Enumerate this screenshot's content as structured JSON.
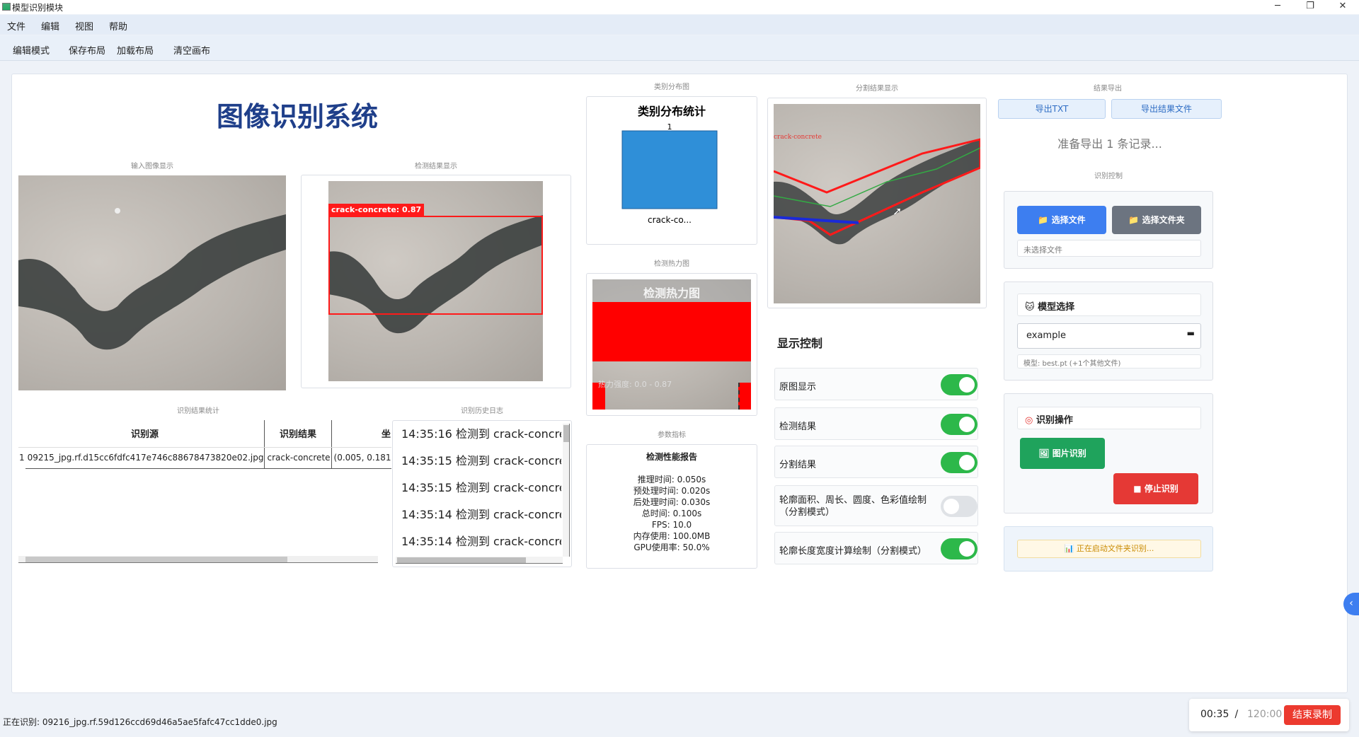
{
  "window": {
    "title": "模型识别模块",
    "minimize": "─",
    "restore": "❐",
    "close": "✕"
  },
  "menu": [
    "文件",
    "编辑",
    "视图",
    "帮助"
  ],
  "toolbar": [
    "编辑模式",
    "保存布局",
    "加载布局",
    "清空画布"
  ],
  "main_title": "图像识别系统",
  "sections": {
    "input_image": "输入图像显示",
    "detect_result": "检测结果显示",
    "result_stats": "识别结果统计",
    "history_log": "识别历史日志",
    "class_dist": "类别分布图",
    "heatmap": "检测热力图",
    "params": "参数指标",
    "segment": "分割结果显示",
    "export": "结果导出",
    "recog_control": "识别控制"
  },
  "detection": {
    "label": "crack-concrete: 0.87"
  },
  "segmentation": {
    "label": "crack-concrete"
  },
  "table": {
    "headers": [
      "识别源",
      "识别结果",
      "坐"
    ],
    "rows": [
      {
        "index": "1",
        "source": "09215_jpg.rf.d15cc6fdfc417e746c88678473820e02.jpg",
        "result": "crack-concrete",
        "coord": "(0.005, 0.181,"
      }
    ]
  },
  "log": [
    "14:35:16 检测到 crack-concret",
    "14:35:15 检测到 crack-concret",
    "14:35:15 检测到 crack-concret",
    "14:35:14 检测到 crack-concret",
    "14:35:14 检测到 crack-concret"
  ],
  "chart_data": {
    "type": "bar",
    "title": "类别分布统计",
    "categories": [
      "crack-co..."
    ],
    "values": [
      1
    ],
    "ylim": [
      0,
      1
    ],
    "grid": false,
    "color": "#2f8fd8"
  },
  "heatmap": {
    "title": "检测热力图",
    "range_label": "热力强度: 0.0 - 0.87"
  },
  "report": {
    "title": "检测性能报告",
    "lines": [
      "推理时间: 0.050s",
      "预处理时间: 0.020s",
      "后处理时间: 0.030s",
      "总时间: 0.100s",
      "FPS: 10.0",
      "内存使用: 100.0MB",
      "GPU使用率: 50.0%"
    ]
  },
  "display_control": {
    "title": "显示控制",
    "items": [
      {
        "label": "原图显示",
        "on": true
      },
      {
        "label": "检测结果",
        "on": true
      },
      {
        "label": "分割结果",
        "on": true
      },
      {
        "label": "轮廓面积、周长、圆度、色彩值绘制（分割模式）",
        "on": false
      },
      {
        "label": "轮廓长度宽度计算绘制（分割模式）",
        "on": true
      }
    ]
  },
  "export": {
    "txt_button": "导出TXT",
    "file_button": "导出结果文件",
    "status": "准备导出 1 条记录..."
  },
  "controls": {
    "select_file": "选择文件",
    "select_folder": "选择文件夹",
    "file_status": "未选择文件",
    "model_title": "模型选择",
    "model_value": "example",
    "model_info": "模型: best.pt (+1个其他文件)",
    "op_title": "识别操作",
    "image_recog": "图片识别",
    "stop_recog": "停止识别",
    "progress": "正在启动文件夹识别..."
  },
  "status_bar": {
    "text": "正在识别: 09216_jpg.rf.59d126ccd69d46a5ae5fafc47cc1dde0.jpg"
  },
  "recorder": {
    "elapsed": "00:35",
    "sep": " / ",
    "total": "120:00",
    "stop": "结束录制"
  },
  "colors": {
    "accent": "#3b7ddd",
    "green": "#1fa35c",
    "red": "#e53935",
    "title_blue": "#1f3f8a"
  }
}
